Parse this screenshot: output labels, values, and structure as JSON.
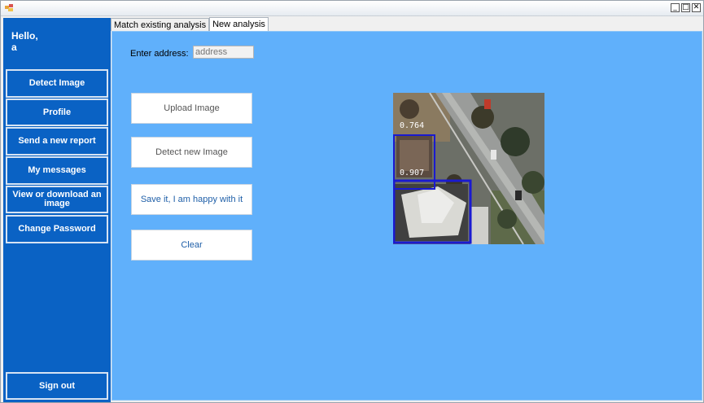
{
  "window": {
    "controls": {
      "minimize": "_",
      "maximize": "□",
      "close": "✕"
    }
  },
  "sidebar": {
    "greeting_line1": "Hello,",
    "greeting_line2": "a",
    "items": [
      {
        "label": "Detect Image"
      },
      {
        "label": "Profile"
      },
      {
        "label": "Send a new report"
      },
      {
        "label": "My messages"
      },
      {
        "label": "View or download an image"
      },
      {
        "label": "Change Password"
      }
    ],
    "sign_out": "Sign out"
  },
  "tabs": [
    {
      "label": "Match existing analysis",
      "active": false
    },
    {
      "label": "New analysis",
      "active": true
    }
  ],
  "form": {
    "address_label": "Enter address:",
    "address_placeholder": "address"
  },
  "actions": {
    "upload": "Upload Image",
    "detect": "Detect new Image",
    "save": "Save it, I am happy with it",
    "clear": "Clear"
  },
  "preview": {
    "detections": [
      {
        "score": "0.764"
      },
      {
        "score": "0.907"
      }
    ]
  },
  "colors": {
    "sidebar": "#0a62c4",
    "panel": "#60b0fb",
    "detection_box": "#1a1ad0",
    "action_text_blue": "#1f5fa8",
    "action_text_gray": "#555555"
  }
}
